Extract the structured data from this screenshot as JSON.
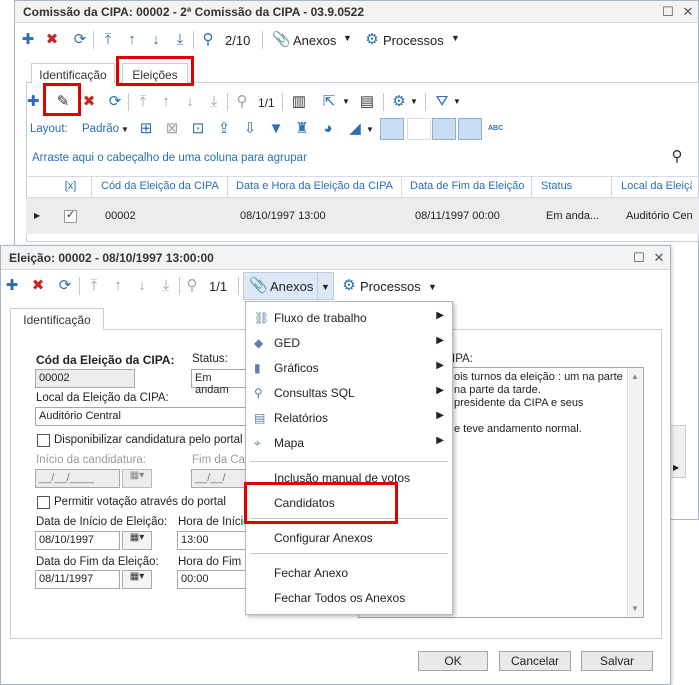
{
  "back_window": {
    "title": "Comissão da CIPA: 00002 - 2ª Comissão da CIPA - 03.9.0522",
    "pager": "2/10",
    "anexos_label": "Anexos",
    "processos_label": "Processos",
    "tabs": [
      "Identificação",
      "Eleições"
    ],
    "grid_pager": "1/1",
    "layout_label": "Layout:",
    "layout_value": "Padrão",
    "group_hint": "Arraste aqui o cabeçalho de uma coluna para agrupar",
    "columns": [
      "[x]",
      "Cód da Eleição da CIPA",
      "Data e Hora da Eleição da CIPA",
      "Data de Fim da Eleição",
      "Status",
      "Local da Eleição"
    ],
    "row": {
      "cod": "00002",
      "data_hora": "08/10/1997 13:00",
      "data_fim": "08/11/1997 00:00",
      "status": "Em anda...",
      "local": "Auditório Cen"
    }
  },
  "front_window": {
    "title": "Eleição: 00002 - 08/10/1997 13:00:00",
    "pager": "1/1",
    "anexos_label": "Anexos",
    "processos_label": "Processos",
    "tab_label": "Identificação",
    "fields": {
      "cod_label": "Cód da Eleição da CIPA:",
      "cod_value": "00002",
      "status_label": "Status:",
      "status_value": "Em andam",
      "local_label": "Local da Eleição da CIPA:",
      "local_value": "Auditório Central",
      "disp_label": "Disponibilizar candidatura pelo portal",
      "inicio_cand_label": "Início da candidatura:",
      "inicio_cand_value": "__/__/____",
      "fim_cand_label": "Fim da Can",
      "fim_cand_value": "__/__/",
      "permitir_label": "Permitir votação através do portal",
      "data_inicio_label": "Data de Início de Eleição:",
      "data_inicio_value": "08/10/1997",
      "hora_inicio_label": "Hora de Início",
      "hora_inicio_value": "13:00",
      "data_fim_label": "Data do Fim da Eleição:",
      "data_fim_value": "08/11/1997",
      "hora_fim_label": "Hora do Fim d",
      "hora_fim_value": "00:00",
      "obs_label": "IPA:",
      "obs_lines": [
        "ois turnos da eleição : um  na parte",
        "na parte da tarde.",
        "presidente da CIPA e seus",
        "",
        "e teve andamento normal."
      ]
    },
    "buttons": {
      "ok": "OK",
      "cancel": "Cancelar",
      "save": "Salvar"
    }
  },
  "menu": {
    "items": [
      {
        "label": "Fluxo de trabalho",
        "icon": "workflow-icon",
        "submenu": true
      },
      {
        "label": "GED",
        "icon": "ged-icon",
        "submenu": true
      },
      {
        "label": "Gráficos",
        "icon": "chart-icon",
        "submenu": true
      },
      {
        "label": "Consultas SQL",
        "icon": "search-icon",
        "submenu": true
      },
      {
        "label": "Relatórios",
        "icon": "report-icon",
        "submenu": true
      },
      {
        "label": "Mapa",
        "icon": "map-pin-icon",
        "submenu": true
      }
    ],
    "inclusao": "Inclusão manual de votos",
    "candidatos": "Candidatos",
    "configurar": "Configurar Anexos",
    "fechar": "Fechar Anexo",
    "fechar_todos": "Fechar Todos os Anexos"
  },
  "colors": {
    "accent": "#2a6fb3",
    "highlight": "#e00000"
  }
}
